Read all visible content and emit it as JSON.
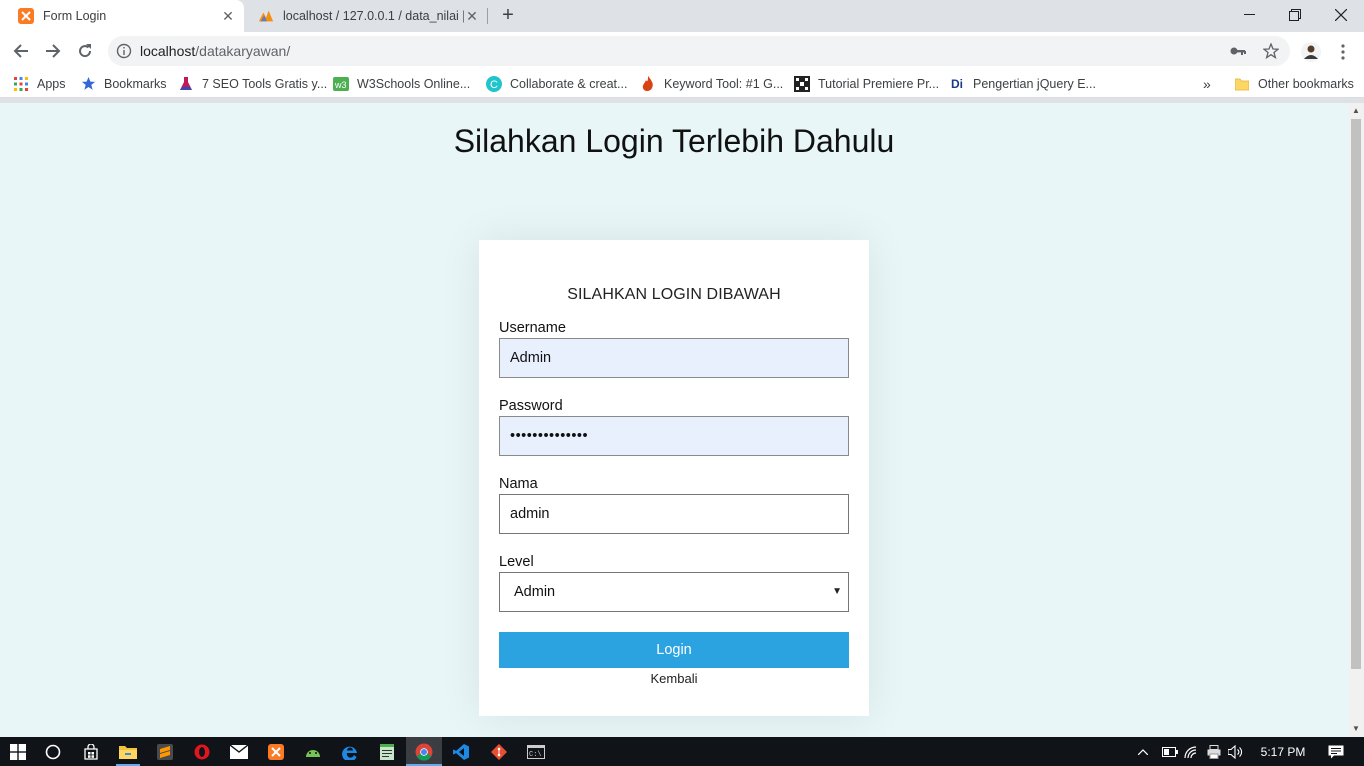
{
  "browser": {
    "tabs": [
      {
        "title": "Form Login",
        "active": true
      },
      {
        "title": "localhost / 127.0.0.1 / data_nilai |",
        "active": false
      }
    ],
    "url_host": "localhost",
    "url_path": "/datakaryawan/",
    "bookmarks": [
      {
        "label": "Apps",
        "icon": "apps-grid-icon"
      },
      {
        "label": "Bookmarks",
        "icon": "star-icon"
      },
      {
        "label": "7 SEO Tools Gratis y...",
        "icon": "flask-icon"
      },
      {
        "label": "W3Schools Online...",
        "icon": "w3schools-icon"
      },
      {
        "label": "Collaborate & creat...",
        "icon": "canva-icon"
      },
      {
        "label": "Keyword Tool: #1 G...",
        "icon": "flame-icon"
      },
      {
        "label": "Tutorial Premiere Pr...",
        "icon": "film-icon"
      },
      {
        "label": "Pengertian jQuery E...",
        "icon": "di-icon"
      }
    ],
    "bookmarks_overflow": "»",
    "other_bookmarks": "Other bookmarks"
  },
  "page": {
    "title": "Silahkan Login Terlebih Dahulu",
    "form": {
      "heading": "SILAHKAN LOGIN DIBAWAH",
      "username_label": "Username",
      "username_value": "Admin",
      "password_label": "Password",
      "password_value": "••••••••••••••",
      "nama_label": "Nama",
      "nama_value": "admin",
      "level_label": "Level",
      "level_selected": "Admin",
      "login_button": "Login",
      "back_link": "Kembali"
    }
  },
  "taskbar": {
    "time": "5:17 PM",
    "pinned": [
      "start-icon",
      "cortana-icon",
      "store-icon",
      "file-explorer-icon",
      "sublime-icon",
      "opera-icon",
      "mail-icon",
      "xampp-icon",
      "android-studio-icon",
      "edge-icon",
      "notepad-icon",
      "chrome-icon",
      "vscode-icon",
      "git-icon",
      "cmd-icon"
    ]
  },
  "colors": {
    "page_background": "#e8f6f8",
    "login_button": "#2aa3e0",
    "autofill_background": "#e8f0fe"
  }
}
